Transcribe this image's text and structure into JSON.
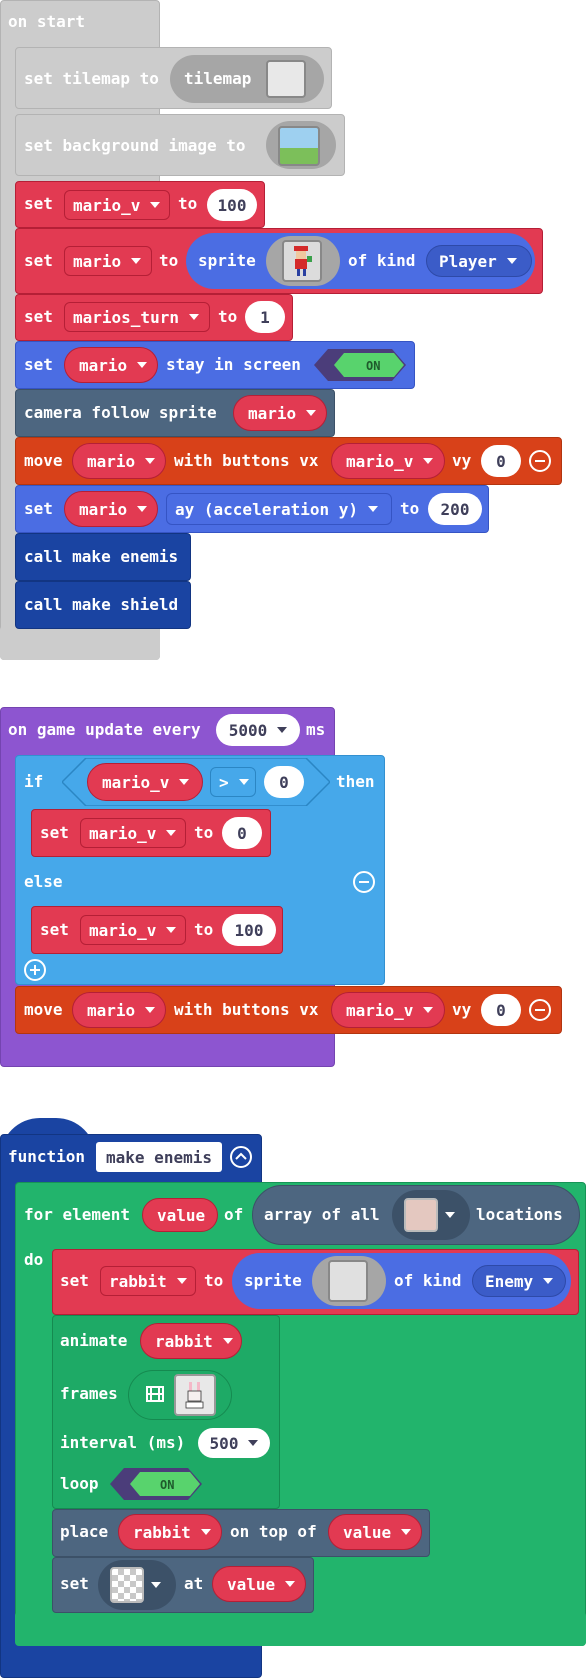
{
  "on_start": {
    "header": "on start",
    "set_tilemap": {
      "text": "set tilemap to",
      "tilemap_label": "tilemap"
    },
    "set_bg": {
      "text": "set background image to"
    },
    "set_mario_v": {
      "set": "set",
      "var": "mario_v",
      "to": "to",
      "value": "100"
    },
    "set_mario": {
      "set": "set",
      "var": "mario",
      "to": "to",
      "sprite": "sprite",
      "of_kind": "of kind",
      "kind": "Player"
    },
    "set_turn": {
      "set": "set",
      "var": "marios_turn",
      "to": "to",
      "value": "1"
    },
    "stay": {
      "set": "set",
      "var": "mario",
      "text": "stay in screen",
      "toggle": "ON"
    },
    "camera": {
      "text": "camera follow sprite",
      "var": "mario"
    },
    "move": {
      "move": "move",
      "var": "mario",
      "with": "with buttons vx",
      "vx": "mario_v",
      "vy": "vy",
      "vy_value": "0"
    },
    "set_ay": {
      "set": "set",
      "var": "mario",
      "prop": "ay (acceleration y)",
      "to": "to",
      "value": "200"
    },
    "call1": "call make enemis",
    "call2": "call make shield"
  },
  "on_update": {
    "header": "on game update every",
    "interval": "5000",
    "unit": "ms",
    "if": "if",
    "cond_var": "mario_v",
    "op": ">",
    "cond_value": "0",
    "then": "then",
    "set1": {
      "set": "set",
      "var": "mario_v",
      "to": "to",
      "value": "0"
    },
    "else": "else",
    "set2": {
      "set": "set",
      "var": "mario_v",
      "to": "to",
      "value": "100"
    },
    "move": {
      "move": "move",
      "var": "mario",
      "with": "with buttons vx",
      "vx": "mario_v",
      "vy": "vy",
      "vy_value": "0"
    }
  },
  "function": {
    "keyword": "function",
    "name": "make enemis",
    "for": {
      "text": "for element",
      "var": "value",
      "of": "of",
      "array": "array of all",
      "locations": "locations",
      "do": "do"
    },
    "set_rabbit": {
      "set": "set",
      "var": "rabbit",
      "to": "to",
      "sprite": "sprite",
      "of_kind": "of kind",
      "kind": "Enemy"
    },
    "animate": {
      "text": "animate",
      "var": "rabbit",
      "frames": "frames",
      "interval": "interval (ms)",
      "interval_value": "500",
      "loop": "loop",
      "toggle": "ON"
    },
    "place": {
      "text": "place",
      "var": "rabbit",
      "on_top": "on top of",
      "target": "value"
    },
    "set_tile": {
      "set": "set",
      "at": "at",
      "target": "value"
    }
  },
  "colors": {
    "grey_block": "#cccccc",
    "red_block": "#e23a52",
    "blue_block": "#4b6de3",
    "slate_block": "#4d6680",
    "orange_block": "#d84119",
    "navy_block": "#1a44a2",
    "purple_block": "#8d55d0",
    "lightblue_block": "#46a8ea",
    "green_block": "#22b46c",
    "toggle_on": "#58d36d"
  }
}
